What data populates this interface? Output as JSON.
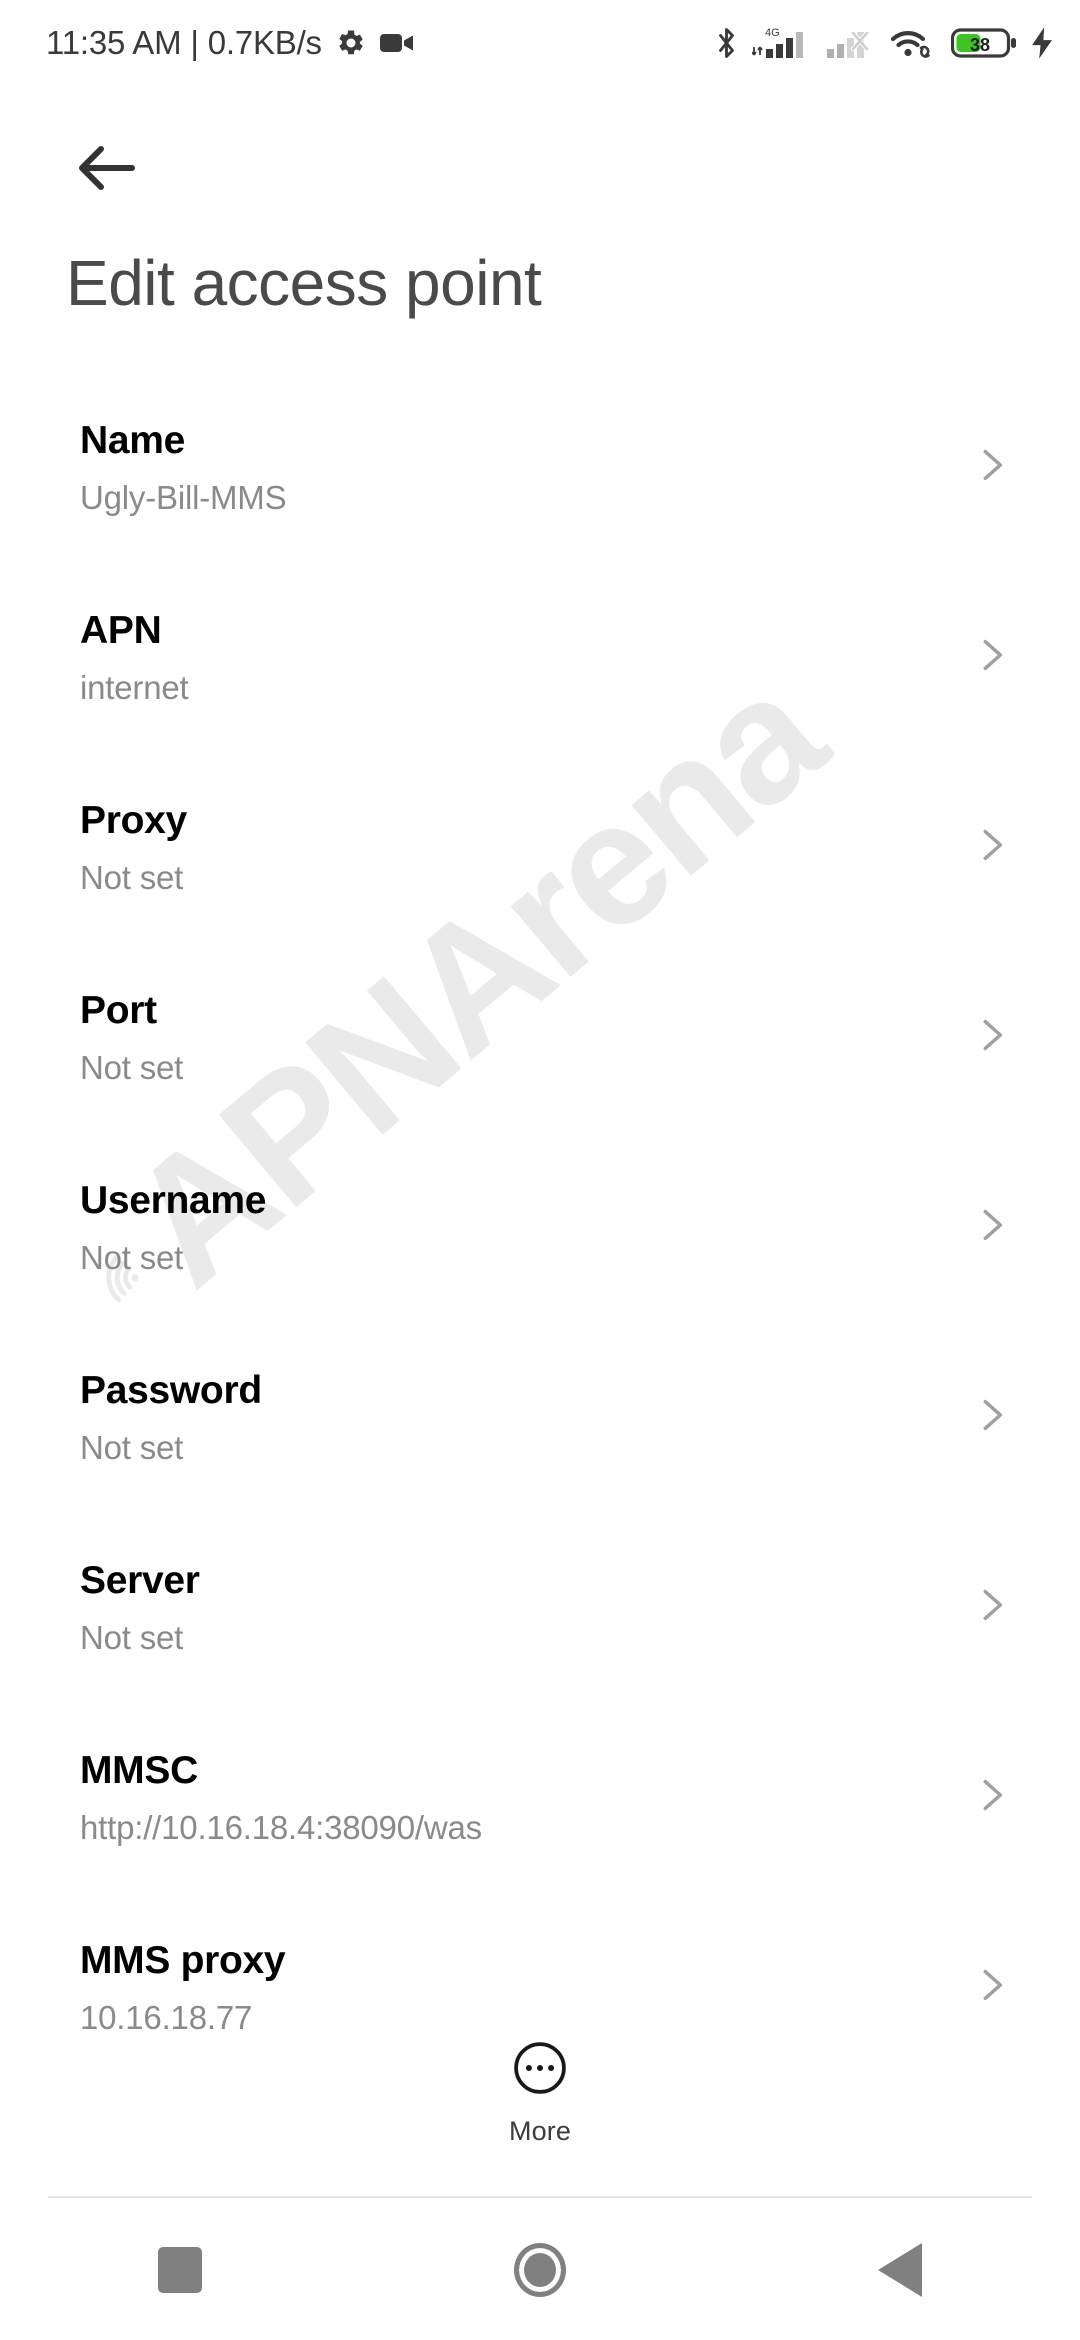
{
  "statusbar": {
    "clock": "11:35 AM | 0.7KB/s",
    "icons": {
      "settings": "gear-icon",
      "recording": "video-camera-icon",
      "bluetooth": "bluetooth-icon",
      "network_type": "4G",
      "signal1": "cellular-signal-icon",
      "signal2": "cellular-no-service-icon",
      "wifi": "wifi-link-icon",
      "battery": "battery-icon",
      "charging": "charging-bolt-icon"
    },
    "battery_level": "38",
    "battery_color": "#3ec325"
  },
  "navigation": {
    "back_label": "back-arrow"
  },
  "header": {
    "title": "Edit access point"
  },
  "watermark": {
    "text": "APNArena",
    "color": "#eaeaea"
  },
  "settings_list": [
    {
      "title": "Name",
      "value": "Ugly-Bill-MMS"
    },
    {
      "title": "APN",
      "value": "internet"
    },
    {
      "title": "Proxy",
      "value": "Not set"
    },
    {
      "title": "Port",
      "value": "Not set"
    },
    {
      "title": "Username",
      "value": "Not set"
    },
    {
      "title": "Password",
      "value": "Not set"
    },
    {
      "title": "Server",
      "value": "Not set"
    },
    {
      "title": "MMSC",
      "value": "http://10.16.18.4:38090/was"
    },
    {
      "title": "MMS proxy",
      "value": "10.16.18.77"
    }
  ],
  "more_button": {
    "label": "More",
    "icon": "more-circle-icon"
  },
  "system_nav": {
    "recents": "recents-square-icon",
    "home": "home-circle-icon",
    "back": "back-triangle-icon"
  }
}
